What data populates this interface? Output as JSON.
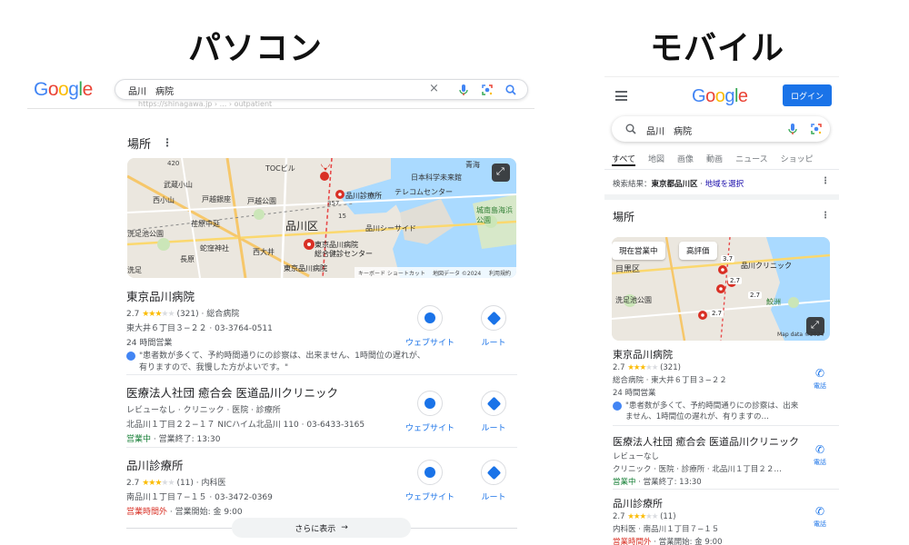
{
  "headings": {
    "desktop": "パソコン",
    "mobile": "モバイル"
  },
  "brand": {
    "letters": [
      "G",
      "o",
      "o",
      "g",
      "l",
      "e"
    ],
    "colors": [
      "#4285f4",
      "#ea4335",
      "#fbbc05",
      "#4285f4",
      "#34a853",
      "#ea4335"
    ]
  },
  "desktop": {
    "query": "品川　病院",
    "clear": "×",
    "ghost_url": "https://shinagawa.jp › ... › outpatient",
    "section_title": "場所",
    "map": {
      "labels": [
        "TOCビル",
        "日本科学未来館",
        "青海",
        "武蔵小山",
        "戸越銀座",
        "戸越公園",
        "西小山",
        "荏原中延",
        "品川区",
        "品川シーサイド",
        "洗足池公園",
        "蛇窪神社",
        "西大井",
        "長原",
        "洗足",
        "東京品川病院",
        "総合健診センター",
        "東京品川病院",
        "品川診療所",
        "テレコムセンター",
        "城南島海浜公園",
        "420",
        "15",
        "357",
        "キーボード ショートカット",
        "地図データ ©2024",
        "利用規約"
      ]
    },
    "listings": [
      {
        "name": "東京品川病院",
        "rating": "2.7",
        "rating_value": 2.7,
        "count": "(321)",
        "category": "総合病院",
        "address": "東大井６丁目３−２２ · 03-3764-0511",
        "status": "24 時間営業",
        "status_color": "#188038",
        "status_extra": "",
        "review": "\"患者数が多くて、予約時間通りにの診察は、出来ません、1時間位の遅れが、有りますので、我慢した方がよいです。\"",
        "website": "ウェブサイト",
        "route": "ルート"
      },
      {
        "name": "医療法人社団 癒合会 医道品川クリニック",
        "rating": "レビューなし",
        "rating_value": 0,
        "count": "",
        "category": "クリニック · 医院 · 診療所",
        "address": "北品川１丁目２２−１７ NICハイム北品川 110 · 03-6433-3165",
        "status": "営業中",
        "status_color": "#188038",
        "status_extra": " · 営業終了: 13:30",
        "review": "",
        "website": "ウェブサイト",
        "route": "ルート"
      },
      {
        "name": "品川診療所",
        "rating": "2.7",
        "rating_value": 2.7,
        "count": "(11)",
        "category": "内科医",
        "address": "南品川１丁目７−１５ · 03-3472-0369",
        "status": "営業時間外",
        "status_color": "#d93025",
        "status_extra": " · 営業開始: 金 9:00",
        "review": "",
        "website": "ウェブサイト",
        "route": "ルート"
      }
    ],
    "more_label": "さらに表示",
    "more_arrow": "→"
  },
  "mobile": {
    "login": "ログイン",
    "query": "品川　病院",
    "tabs": [
      "すべて",
      "地図",
      "画像",
      "動画",
      "ニュース",
      "ショッピ"
    ],
    "scope_prefix": "検索結果：",
    "scope_place": "東京都品川区",
    "scope_sep": " · ",
    "scope_link": "地域を選択",
    "section_title": "場所",
    "chips": [
      "現在営業中",
      "高評価"
    ],
    "map": {
      "labels": [
        "目黒区",
        "3.7",
        "品川クリニック",
        "2.7",
        "2.7",
        "2.7",
        "洗足池公園",
        "鮫洲",
        "Map data ©2024"
      ]
    },
    "listings": [
      {
        "name": "東京品川病院",
        "rating": "2.7",
        "rating_value": 2.7,
        "count": "(321)",
        "line2": "総合病院 · 東大井６丁目３−２２",
        "status": "24 時間営業",
        "status_color": "#188038",
        "status_extra": "",
        "review": "\"患者数が多くて、予約時間通りにの診察は、出来ません、1時間位の遅れが、有りますの…",
        "call": "電話"
      },
      {
        "name": "医療法人社団 癒合会 医道品川クリニック",
        "rating": "レビューなし",
        "rating_value": 0,
        "count": "",
        "line2": "クリニック · 医院 · 診療所 · 北品川１丁目２２…",
        "status": "営業中",
        "status_color": "#188038",
        "status_extra": " · 営業終了: 13:30",
        "review": "",
        "call": "電話"
      },
      {
        "name": "品川診療所",
        "rating": "2.7",
        "rating_value": 2.7,
        "count": "(11)",
        "line2": "内科医 · 南品川１丁目７−１５",
        "status": "営業時間外",
        "status_color": "#d93025",
        "status_extra": " · 営業開始: 金 9:00",
        "review": "",
        "call": "電話"
      }
    ]
  }
}
